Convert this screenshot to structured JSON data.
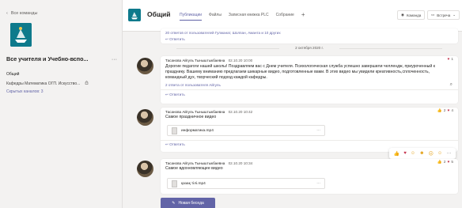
{
  "sidebar": {
    "back_label": "Все команды",
    "team_name": "Все учителя и Учебно-вспо...",
    "more": "···",
    "channels": [
      {
        "label": "Общий"
      },
      {
        "label": "Кафедры Математика ОГП. Искусство..."
      },
      {
        "label": "Скрытых каналов: 3"
      }
    ]
  },
  "header": {
    "title": "Общий",
    "tabs": [
      "Публикации",
      "Файлы",
      "Записная книжка PLC",
      "Собрание"
    ],
    "add_tab": "+",
    "team_button": "Команда",
    "meet_button": "Встреча"
  },
  "feed": {
    "top_replies": "20 ответов от пользователей Гулжанат, Шолпан, Аманта и 10 других",
    "reply_label": "Ответить",
    "date_separator": "2 октября 2020 г.",
    "posts": [
      {
        "author": "Тасанова Айгуль Тыныштыкбаевна",
        "time": "02.10.20 10:00",
        "text": "Дорогие педагоги нашей школы! Поздравляем вас с Днем учителя. Психологическая служба успешно завершили челлендж, приуроченный к празднику. Вашему вниманию предлагаем шикарные видео, подготовленные вами. В этих видео мы увидели креативность,сплоченность, командный дух, творческий подход каждой кафедры.",
        "replies": "2 ответа от пользователя Айгуль",
        "reactions": {
          "heart": "1"
        }
      },
      {
        "author": "Тасанова Айгуль Тыныштыкбаевна",
        "time": "02.10.20 10:42",
        "text": "Самое праздничное видео",
        "file": "информатика.mp4",
        "reactions": {
          "like": "2",
          "heart": "4"
        }
      },
      {
        "author": "Тасанова Айгуль Тыныштыкбаевна",
        "time": "02.10.20 10:34",
        "text": "Самое вдохновляющее видео",
        "file": "қазақ тілі.mp4",
        "reactions": {
          "like": "2",
          "heart": "5"
        }
      }
    ],
    "file_more": "···",
    "emoji_more": "···",
    "compose_label": "Новая беседа"
  },
  "colors": {
    "accent": "#6264a7",
    "heart": "#c4314b",
    "like": "#e3a21a",
    "team": "#0e7a8c"
  }
}
